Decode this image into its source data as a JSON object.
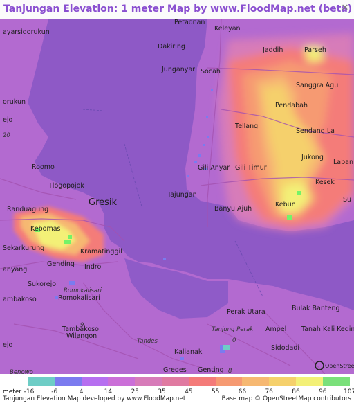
{
  "title": "Tanjungan Elevation: 1 meter Map by www.FloodMap.net (beta)",
  "close_icon": "close-icon",
  "places": [
    {
      "name": "Petaonan",
      "style": "place"
    },
    {
      "name": "Keleyan",
      "style": "place"
    },
    {
      "name": "ayarsidorukun",
      "style": "place"
    },
    {
      "name": "Dakiring",
      "style": "place"
    },
    {
      "name": "Jaddih",
      "style": "place"
    },
    {
      "name": "Parseh",
      "style": "place"
    },
    {
      "name": "Junganyar",
      "style": "place"
    },
    {
      "name": "Socah",
      "style": "place"
    },
    {
      "name": "Sanggra Agu",
      "style": "place"
    },
    {
      "name": "orukun",
      "style": "place"
    },
    {
      "name": "Pendabah",
      "style": "place"
    },
    {
      "name": "ejo",
      "style": "place"
    },
    {
      "name": "Tellang",
      "style": "place"
    },
    {
      "name": "Sendang La",
      "style": "place"
    },
    {
      "name": "Jukong",
      "style": "place"
    },
    {
      "name": "Roomo",
      "style": "place"
    },
    {
      "name": "Gili Anyar",
      "style": "place"
    },
    {
      "name": "Gili Timur",
      "style": "place"
    },
    {
      "name": "Laban",
      "style": "place"
    },
    {
      "name": "Tlogopojok",
      "style": "place"
    },
    {
      "name": "Kesek",
      "style": "place"
    },
    {
      "name": "Tajungan",
      "style": "place"
    },
    {
      "name": "Gresik",
      "style": "place-lg"
    },
    {
      "name": "Randuagung",
      "style": "place"
    },
    {
      "name": "Banyu Ajuh",
      "style": "place"
    },
    {
      "name": "Kebun",
      "style": "place"
    },
    {
      "name": "Su",
      "style": "place"
    },
    {
      "name": "Kebomas",
      "style": "place"
    },
    {
      "name": "Sekarkurung",
      "style": "place"
    },
    {
      "name": "Kramatinggil",
      "style": "place"
    },
    {
      "name": "Gending",
      "style": "place"
    },
    {
      "name": "Indro",
      "style": "place"
    },
    {
      "name": "anyang",
      "style": "place"
    },
    {
      "name": "Sukorejo",
      "style": "place"
    },
    {
      "name": "Romokalisari",
      "style": "place-it"
    },
    {
      "name": "Romokalisari",
      "style": "place"
    },
    {
      "name": "ambakoso",
      "style": "place"
    },
    {
      "name": "Perak Utara",
      "style": "place"
    },
    {
      "name": "Bulak Banteng",
      "style": "place"
    },
    {
      "name": "Tanjung Perak",
      "style": "place-it"
    },
    {
      "name": "Tambakoso",
      "style": "place"
    },
    {
      "name": "Wilangon",
      "style": "place"
    },
    {
      "name": "Ampel",
      "style": "place"
    },
    {
      "name": "Tanah Kali Kedino",
      "style": "place"
    },
    {
      "name": "ejo",
      "style": "place"
    },
    {
      "name": "Kalianak",
      "style": "place"
    },
    {
      "name": "Sidodadi",
      "style": "place"
    },
    {
      "name": "Tandes",
      "style": "place-it"
    },
    {
      "name": "Greges",
      "style": "place"
    },
    {
      "name": "Genting",
      "style": "place"
    },
    {
      "name": "Benowo",
      "style": "place-it"
    }
  ],
  "road_numbers": [
    "20",
    "9",
    "0",
    "8"
  ],
  "osm_logo_text": "OpenStreetMap",
  "legend": {
    "unit": "meter",
    "labels": [
      "-16",
      "-6",
      "4",
      "14",
      "25",
      "35",
      "45",
      "55",
      "66",
      "76",
      "86",
      "96",
      "107"
    ],
    "colors": [
      "#6ecdc6",
      "#7b7bef",
      "#b66ff0",
      "#cb6fd8",
      "#d77bb9",
      "#e07aa1",
      "#f47b79",
      "#f69a72",
      "#f6b872",
      "#f5d06c",
      "#f3f077",
      "#75f368",
      "#7ae07a"
    ]
  },
  "footer": {
    "left": "Tanjungan Elevation Map developed by www.FloodMap.net",
    "right": "Base map © OpenStreetMap contributors"
  }
}
